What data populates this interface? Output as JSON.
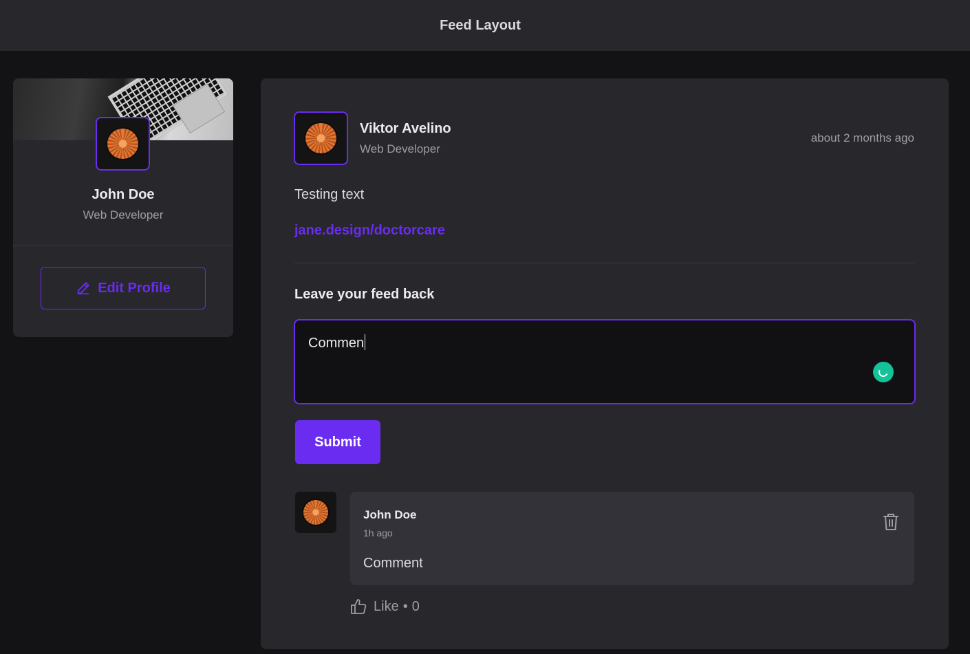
{
  "header": {
    "title": "Feed Layout"
  },
  "profile": {
    "name": "John Doe",
    "role": "Web Developer",
    "edit_label": "Edit Profile"
  },
  "post": {
    "author_name": "Viktor Avelino",
    "author_role": "Web Developer",
    "time": "about 2 months ago",
    "text": "Testing text",
    "link": "jane.design/doctorcare"
  },
  "feedback": {
    "title": "Leave your feed back",
    "input_value": "Commen",
    "submit_label": "Submit"
  },
  "comments": [
    {
      "author": "John Doe",
      "time": "1h ago",
      "text": "Comment",
      "like_label": "Like",
      "like_separator": "•",
      "like_count": "0"
    }
  ],
  "colors": {
    "accent": "#6a2cf0",
    "grammar_green": "#15c39a",
    "background": "#131316",
    "card": "#27272c"
  },
  "icons": {
    "edit": "pencil-icon",
    "delete": "trash-icon",
    "like": "thumbs-up-icon",
    "grammar": "grammarly-icon"
  }
}
